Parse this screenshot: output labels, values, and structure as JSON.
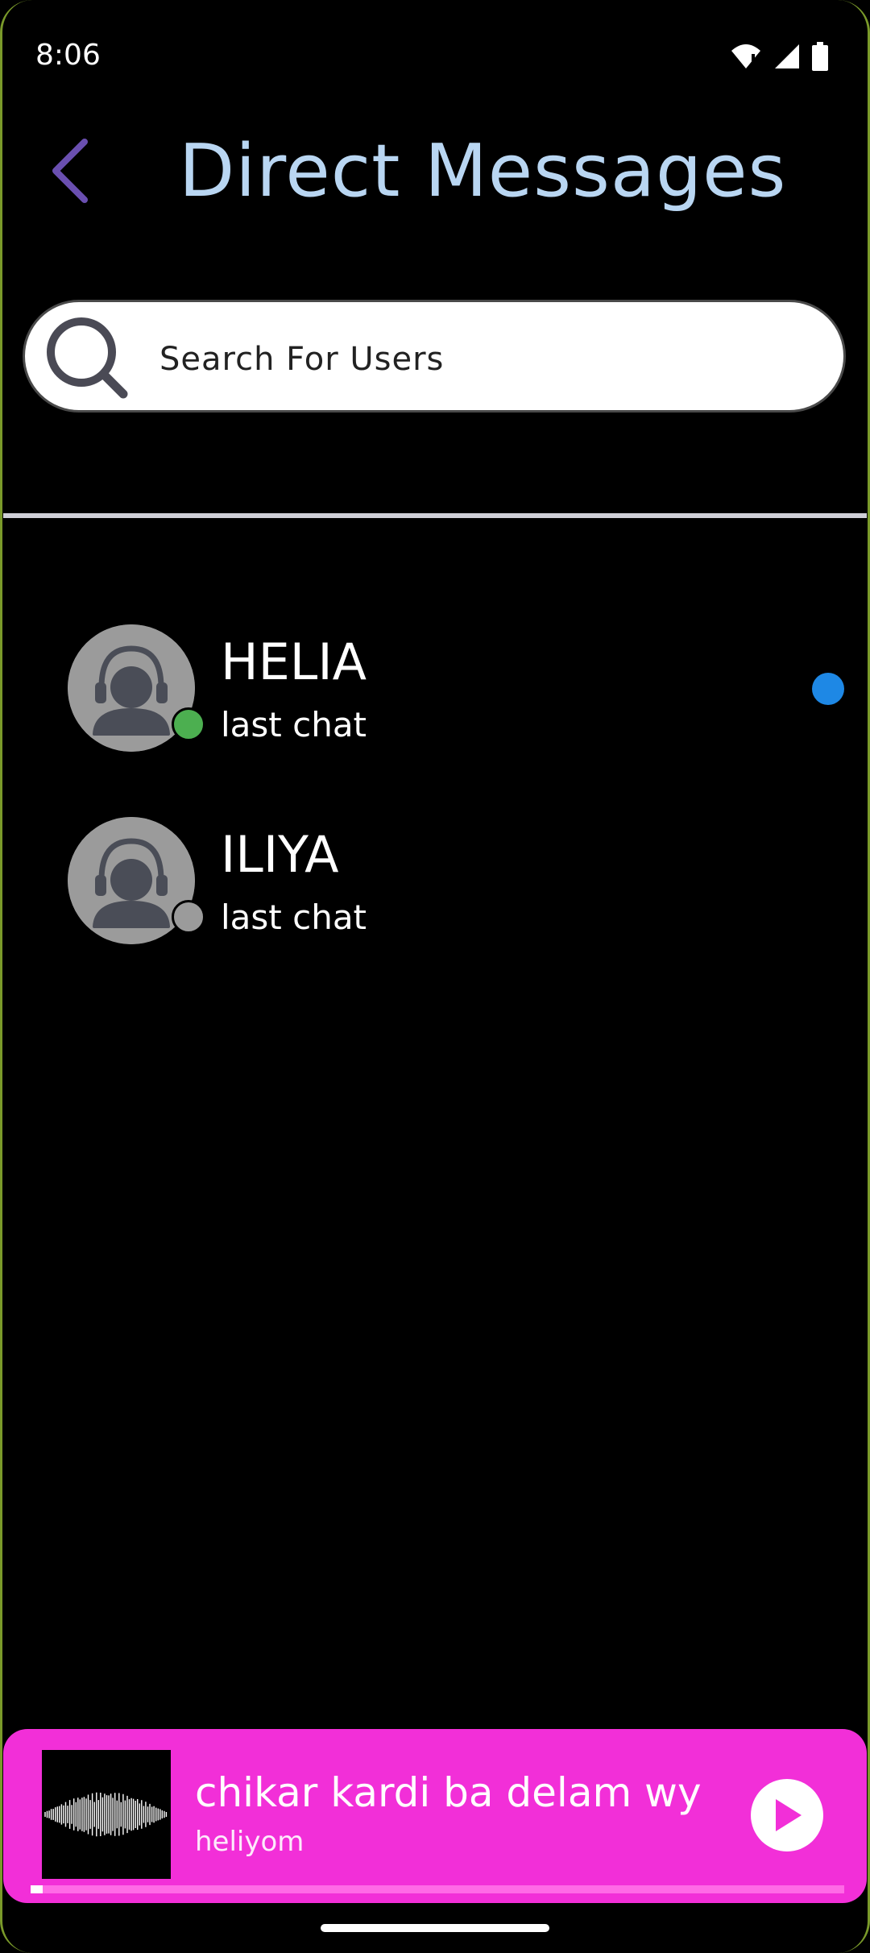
{
  "status_bar": {
    "time": "8:06",
    "icons": [
      "wifi-icon",
      "signal-icon",
      "battery-icon"
    ]
  },
  "header": {
    "title": "Direct Messages",
    "back_icon": "chevron-left-icon"
  },
  "search": {
    "placeholder": "Search For Users",
    "value": ""
  },
  "chats": [
    {
      "name": "HELIA",
      "last": "last chat",
      "online": true,
      "unread": true
    },
    {
      "name": "ILIYA",
      "last": "last chat",
      "online": false,
      "unread": false
    }
  ],
  "player": {
    "title": "chikar kardi ba delam wy",
    "artist": "heliyom",
    "progress": 0.015,
    "cover_icon": "waveform-icon",
    "play_icon": "play-icon"
  },
  "colors": {
    "title": "#b9d6f2",
    "back": "#6a4fb0",
    "online": "#4caf50",
    "offline": "#9b9b9b",
    "unread": "#1e88e5",
    "player_bg": "#f22fd8"
  }
}
